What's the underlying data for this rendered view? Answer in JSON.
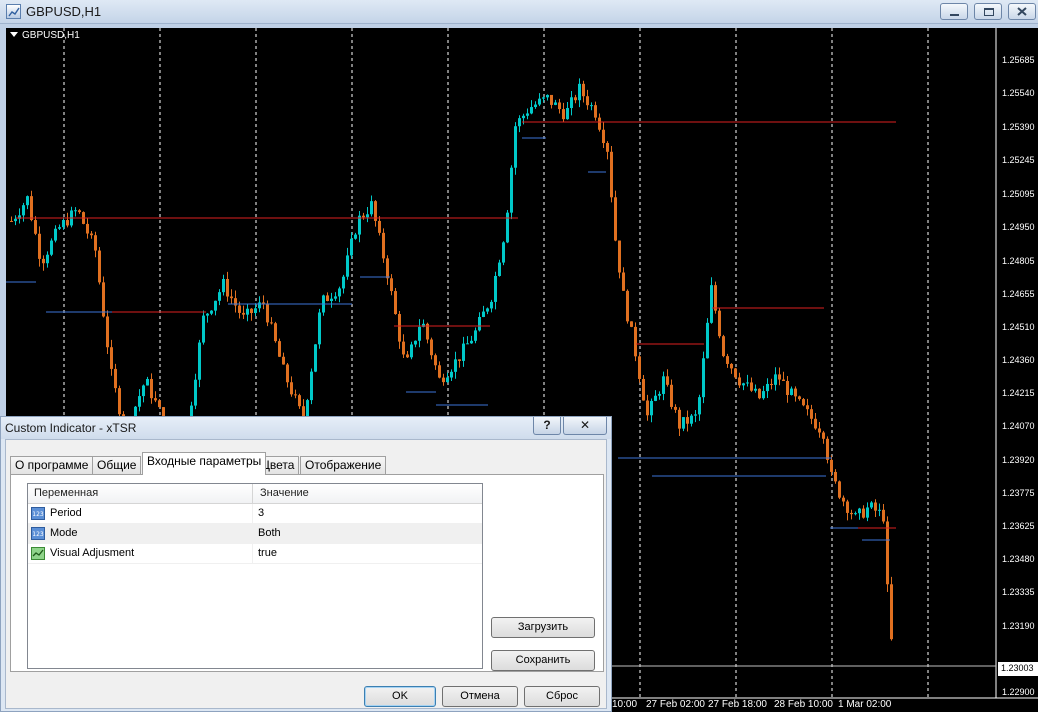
{
  "window": {
    "title": "GBPUSD,H1"
  },
  "chart": {
    "symbol_label": "GBPUSD,H1",
    "price_axis": [
      "1.25685",
      "1.25540",
      "1.25390",
      "1.25245",
      "1.25095",
      "1.24950",
      "1.24805",
      "1.24655",
      "1.24510",
      "1.24360",
      "1.24215",
      "1.24070",
      "1.23920",
      "1.23775",
      "1.23625",
      "1.23480",
      "1.23335",
      "1.23190",
      "1.22900"
    ],
    "current_price": "1.23003",
    "time_axis": [
      "10:00",
      "27 Feb 02:00",
      "27 Feb 18:00",
      "28 Feb 10:00",
      "1 Mar 02:00"
    ],
    "colors": {
      "background": "#000000",
      "bull": "#00c8c8",
      "bear": "#e07020",
      "resistance": "#dd2020",
      "support": "#3d74d8",
      "grid": "#ffffff"
    }
  },
  "dialog": {
    "title": "Custom Indicator - xTSR",
    "help_label": "?",
    "close_label": "✕",
    "tabs": [
      {
        "label": "О программе",
        "active": false
      },
      {
        "label": "Общие",
        "active": false
      },
      {
        "label": "Входные параметры",
        "active": true
      },
      {
        "label": "Цвета",
        "active": false
      },
      {
        "label": "Отображение",
        "active": false
      }
    ],
    "grid": {
      "col_variable": "Переменная",
      "col_value": "Значение",
      "rows": [
        {
          "icon": "int-param-icon",
          "name": "Period",
          "value": "3"
        },
        {
          "icon": "int-param-icon",
          "name": "Mode",
          "value": "Both"
        },
        {
          "icon": "bool-param-icon",
          "name": "Visual Adjusment",
          "value": "true"
        }
      ]
    },
    "buttons": {
      "load": "Загрузить",
      "save": "Сохранить",
      "ok": "OK",
      "cancel": "Отмена",
      "reset": "Сброс"
    }
  }
}
